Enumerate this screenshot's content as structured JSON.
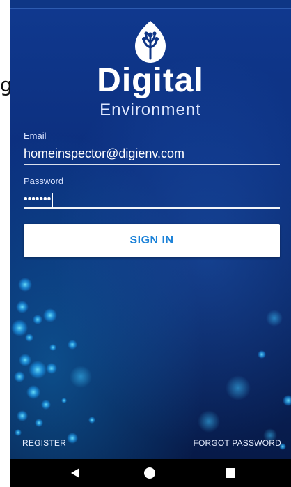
{
  "clipped_edge_text": "g",
  "app": {
    "brand_title": "Digital",
    "brand_subtitle": "Environment",
    "logo_icon": "leaf-tree-icon"
  },
  "form": {
    "email_label": "Email",
    "email_value": "homeinspector@digienv.com",
    "password_label": "Password",
    "password_value": "•••••••",
    "signin_label": "SIGN IN"
  },
  "links": {
    "register": "REGISTER",
    "forgot_password": "FORGOT PASSWORD"
  },
  "navbar": {
    "back_icon": "back-triangle-icon",
    "home_icon": "home-circle-icon",
    "recents_icon": "recents-square-icon"
  },
  "colors": {
    "background_top": "#10398f",
    "background_bottom": "#071a48",
    "button_text": "#1c82d8",
    "text": "#ffffff"
  }
}
